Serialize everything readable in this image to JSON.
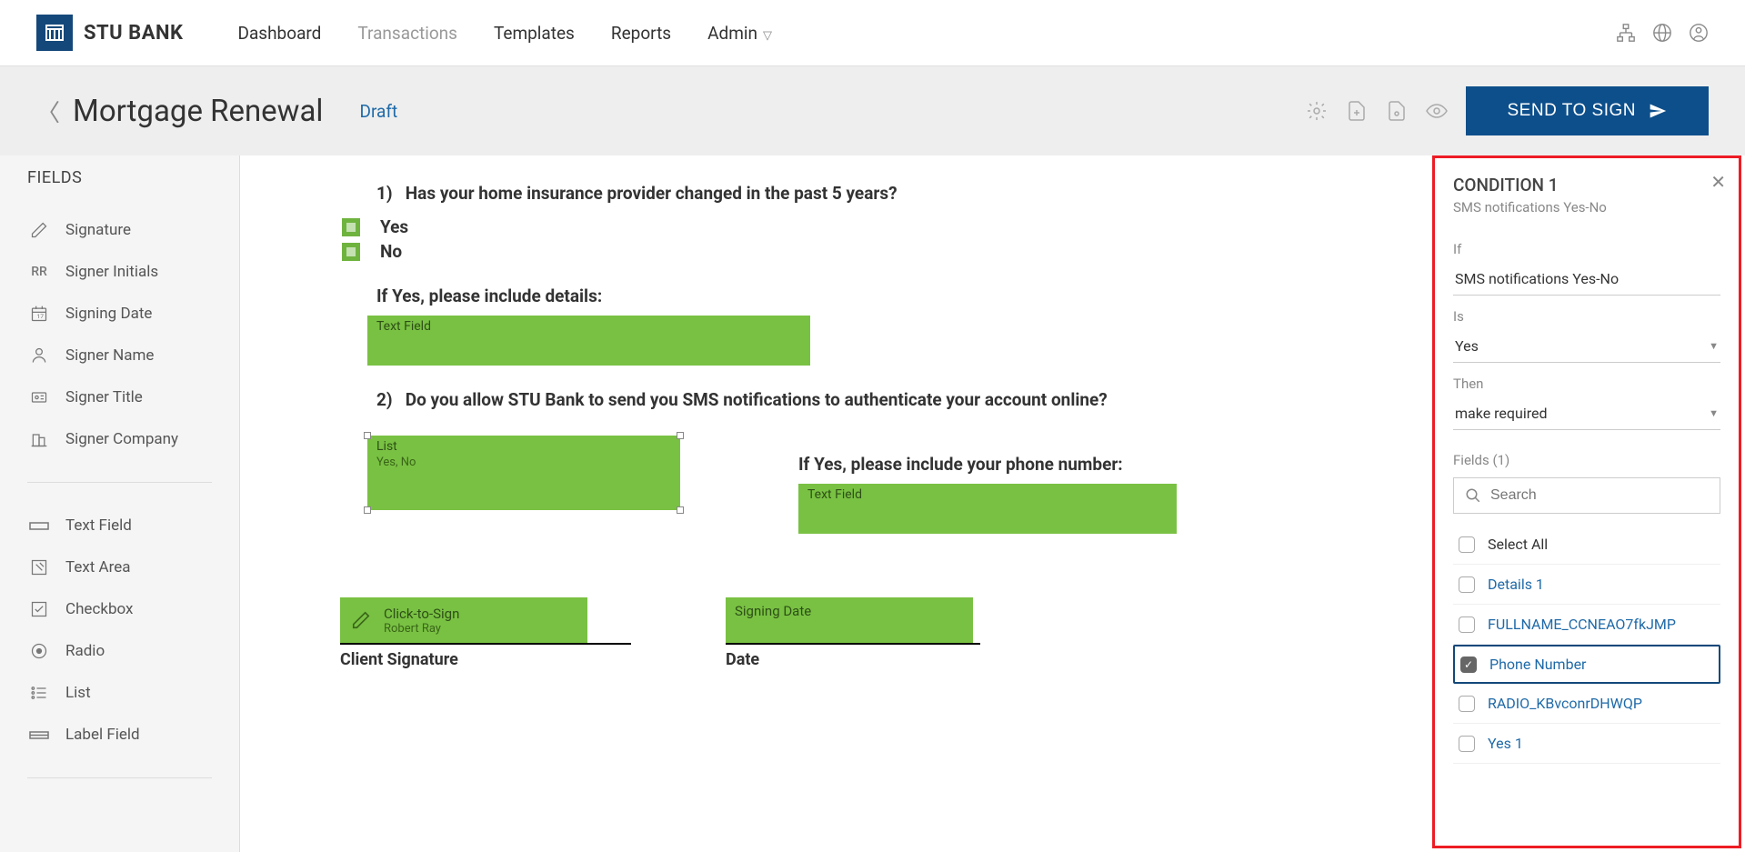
{
  "brand": {
    "name": "STU BANK"
  },
  "nav": {
    "dashboard": "Dashboard",
    "transactions": "Transactions",
    "templates": "Templates",
    "reports": "Reports",
    "admin": "Admin"
  },
  "page": {
    "title": "Mortgage Renewal",
    "status": "Draft",
    "send_button": "SEND TO SIGN"
  },
  "sidebar": {
    "heading": "FIELDS",
    "signature": "Signature",
    "initials_abbr": "RR",
    "initials": "Signer Initials",
    "signing_date": "Signing Date",
    "signer_name": "Signer Name",
    "signer_title": "Signer Title",
    "signer_company": "Signer Company",
    "text_field": "Text Field",
    "text_area": "Text Area",
    "checkbox": "Checkbox",
    "radio": "Radio",
    "list": "List",
    "label_field": "Label Field"
  },
  "doc": {
    "q1_num": "1)",
    "q1_text": "Has your home insurance provider changed in the past 5 years?",
    "yes": "Yes",
    "no": "No",
    "if_yes_details": "If Yes, please include details:",
    "text_field_label": "Text Field",
    "q2_num": "2)",
    "q2_text": "Do you allow STU Bank to send you SMS notifications to authenticate your account online?",
    "list_label": "List",
    "list_options": "Yes, No",
    "if_yes_phone": "If Yes, please include your phone number:",
    "click_to_sign": "Click-to-Sign",
    "signer": "Robert Ray",
    "signing_date_label": "Signing Date",
    "client_signature": "Client Signature",
    "date": "Date"
  },
  "cond": {
    "title": "CONDITION 1",
    "subtitle": "SMS notifications Yes-No",
    "if_label": "If",
    "if_value": "SMS notifications Yes-No",
    "is_label": "Is",
    "is_value": "Yes",
    "then_label": "Then",
    "then_value": "make required",
    "fields_label": "Fields (1)",
    "search_placeholder": "Search",
    "select_all": "Select All",
    "details1": "Details 1",
    "fullname": "FULLNAME_CCNEAO7fkJMP",
    "phone": "Phone Number",
    "radio": "RADIO_KBvconrDHWQP",
    "yes1": "Yes 1"
  }
}
